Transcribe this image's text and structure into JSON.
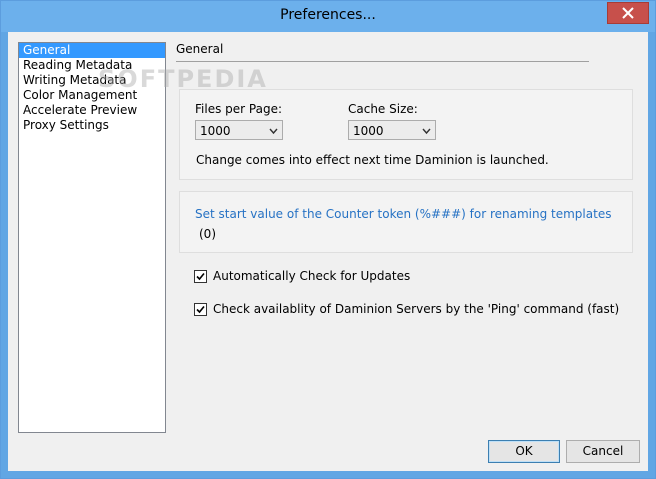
{
  "window": {
    "title": "Preferences..."
  },
  "nav": {
    "items": [
      {
        "label": "General",
        "selected": true
      },
      {
        "label": "Reading Metadata",
        "selected": false
      },
      {
        "label": "Writing Metadata",
        "selected": false
      },
      {
        "label": "Color Management",
        "selected": false
      },
      {
        "label": "Accelerate Preview",
        "selected": false
      },
      {
        "label": "Proxy Settings",
        "selected": false
      }
    ]
  },
  "general": {
    "section_title": "General",
    "files_per_page": {
      "label": "Files per Page:",
      "value": "1000"
    },
    "cache_size": {
      "label": "Cache Size:",
      "value": "1000"
    },
    "note": "Change comes into effect next time Daminion is launched.",
    "counter": {
      "link": "Set start value of the Counter token (%###) for renaming templates",
      "value": "(0)"
    },
    "checkboxes": [
      {
        "label": "Automatically Check for Updates",
        "checked": true
      },
      {
        "label": "Check availablity of Daminion Servers by the 'Ping' command (fast)",
        "checked": true
      }
    ]
  },
  "buttons": {
    "ok": "OK",
    "cancel": "Cancel"
  },
  "watermark": "SOFTPEDIA",
  "colors": {
    "titlebar": "#6cb0ec",
    "close": "#c7504b",
    "selection": "#3399ff",
    "link": "#2672c4"
  }
}
